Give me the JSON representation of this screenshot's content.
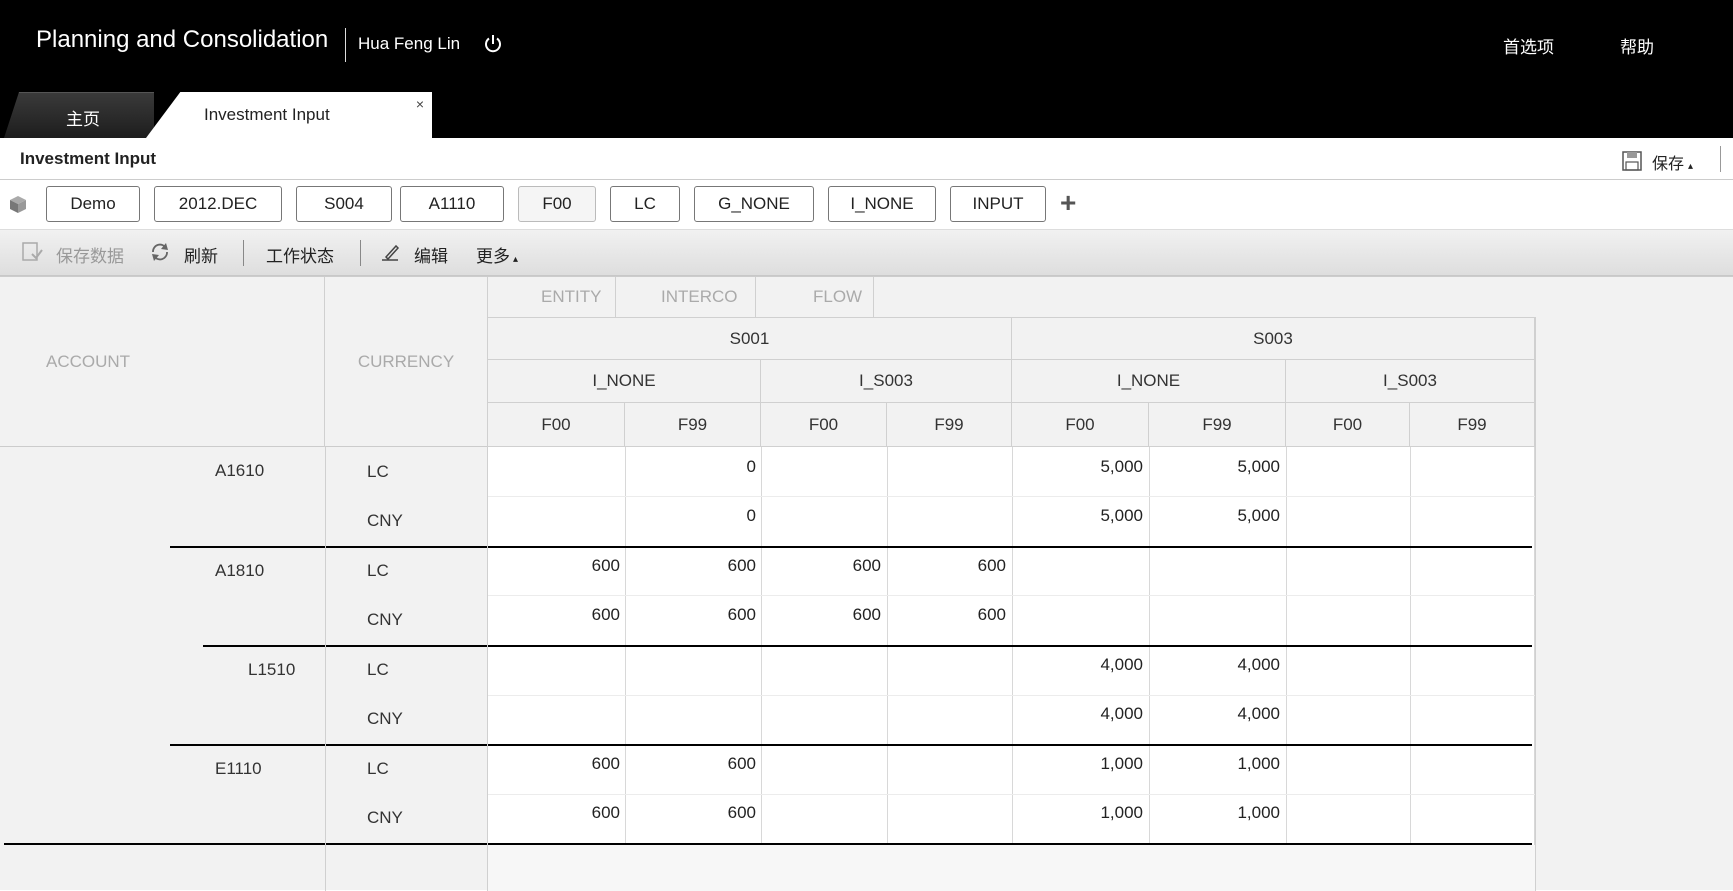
{
  "header": {
    "app_title": "Planning and Consolidation",
    "user_name": "Hua Feng Lin",
    "preferences": "首选项",
    "help": "帮助"
  },
  "tabs": [
    {
      "label": "主页"
    },
    {
      "label": "Investment Input",
      "close": "×"
    }
  ],
  "page": {
    "title": "Investment Input",
    "save_menu": "保存",
    "save_menu_arrow": "▴"
  },
  "context": {
    "members": [
      "Demo",
      "2012.DEC",
      "S004",
      "A1110",
      "F00",
      "LC",
      "G_NONE",
      "I_NONE",
      "INPUT"
    ],
    "add": "+"
  },
  "toolbar": {
    "save_data": "保存数据",
    "refresh": "刷新",
    "work_status": "工作状态",
    "edit": "编辑",
    "more": "更多",
    "more_arrow": "▴"
  },
  "grid": {
    "dimension_labels": [
      "ENTITY",
      "INTERCO",
      "FLOW"
    ],
    "account_header": "ACCOUNT",
    "currency_header": "CURRENCY",
    "entities": [
      "S001",
      "S003"
    ],
    "intercos": [
      "I_NONE",
      "I_S003",
      "I_NONE",
      "I_S003"
    ],
    "flows": [
      "F00",
      "F99",
      "F00",
      "F99",
      "F00",
      "F99",
      "F00",
      "F99"
    ],
    "rows": [
      {
        "account": "A1610",
        "currency": "LC",
        "values": [
          "",
          "0",
          "",
          "",
          "5,000",
          "5,000",
          "",
          ""
        ]
      },
      {
        "account": "",
        "currency": "CNY",
        "values": [
          "",
          "0",
          "",
          "",
          "5,000",
          "5,000",
          "",
          ""
        ]
      },
      {
        "account": "A1810",
        "currency": "LC",
        "values": [
          "600",
          "600",
          "600",
          "600",
          "",
          "",
          "",
          ""
        ]
      },
      {
        "account": "",
        "currency": "CNY",
        "values": [
          "600",
          "600",
          "600",
          "600",
          "",
          "",
          "",
          ""
        ]
      },
      {
        "account": "L1510",
        "currency": "LC",
        "values": [
          "",
          "",
          "",
          "",
          "4,000",
          "4,000",
          "",
          ""
        ]
      },
      {
        "account": "",
        "currency": "CNY",
        "values": [
          "",
          "",
          "",
          "",
          "4,000",
          "4,000",
          "",
          ""
        ]
      },
      {
        "account": "E1110",
        "currency": "LC",
        "values": [
          "600",
          "600",
          "",
          "",
          "1,000",
          "1,000",
          "",
          ""
        ]
      },
      {
        "account": "",
        "currency": "CNY",
        "values": [
          "600",
          "600",
          "",
          "",
          "1,000",
          "1,000",
          "",
          ""
        ]
      }
    ]
  }
}
